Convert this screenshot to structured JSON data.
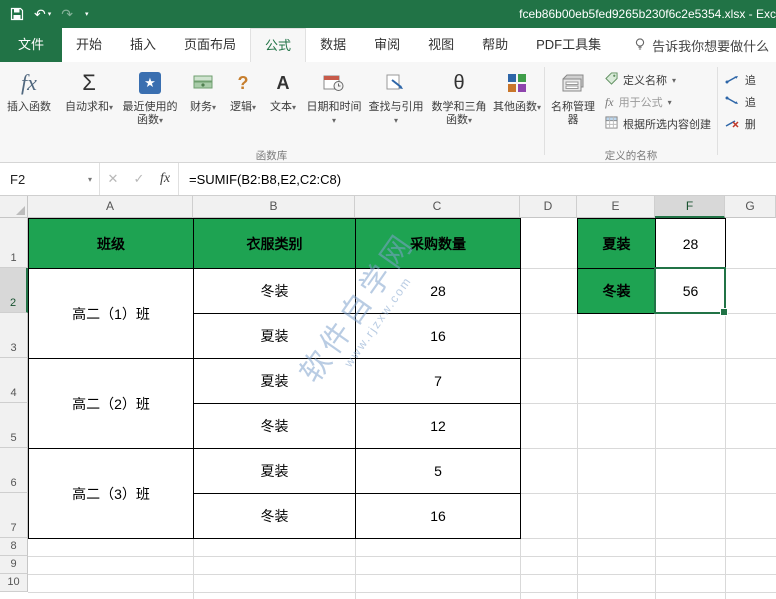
{
  "titlebar": {
    "filename": "fceb86b00eb5fed9265b230f6c2e5354.xlsx  -  Exc"
  },
  "tabs": {
    "file": "文件",
    "items": [
      "开始",
      "插入",
      "页面布局",
      "公式",
      "数据",
      "审阅",
      "视图",
      "帮助",
      "PDF工具集"
    ],
    "active": "公式",
    "tellme": "告诉我你想要做什么"
  },
  "ribbon": {
    "insert_function_label": "插入函数",
    "function_library": {
      "group_label": "函数库",
      "buttons": [
        {
          "label": "自动求和"
        },
        {
          "label": "最近使用的函数"
        },
        {
          "label": "财务"
        },
        {
          "label": "逻辑"
        },
        {
          "label": "文本"
        },
        {
          "label": "日期和时间"
        },
        {
          "label": "查找与引用"
        },
        {
          "label": "数学和三角函数"
        },
        {
          "label": "其他函数"
        }
      ]
    },
    "defined_names": {
      "group_label": "定义的名称",
      "name_manager": "名称管理器",
      "items": [
        "定义名称",
        "用于公式",
        "根据所选内容创建"
      ]
    },
    "clipped_group": {
      "items": [
        "追",
        "追",
        "删"
      ]
    }
  },
  "formula_bar": {
    "name_box": "F2",
    "formula": "=SUMIF(B2:B8,E2,C2:C8)"
  },
  "sheet": {
    "col_headers": [
      "A",
      "B",
      "C",
      "D",
      "E",
      "F",
      "G"
    ],
    "row_headers": [
      "1",
      "2",
      "3",
      "4",
      "5",
      "6",
      "7",
      "8",
      "9",
      "10"
    ],
    "selected_cell": "F2",
    "table": {
      "headers": [
        "班级",
        "衣服类别",
        "采购数量"
      ],
      "groups": [
        {
          "name": "高二（1）班",
          "rows": [
            {
              "type": "冬装",
              "qty": "28"
            },
            {
              "type": "夏装",
              "qty": "16"
            }
          ]
        },
        {
          "name": "高二（2）班",
          "rows": [
            {
              "type": "夏装",
              "qty": "7"
            },
            {
              "type": "冬装",
              "qty": "12"
            }
          ]
        },
        {
          "name": "高二（3）班",
          "rows": [
            {
              "type": "夏装",
              "qty": "5"
            },
            {
              "type": "冬装",
              "qty": "16"
            }
          ]
        }
      ]
    },
    "summary": [
      {
        "label": "夏装",
        "value": "28"
      },
      {
        "label": "冬装",
        "value": "56"
      }
    ]
  },
  "watermark": {
    "line1": "软件自学网",
    "line2": "www.rjzxw.com"
  },
  "colors": {
    "titlebar_green": "#217346",
    "table_green": "#1ea352",
    "selection_green": "#217346"
  }
}
